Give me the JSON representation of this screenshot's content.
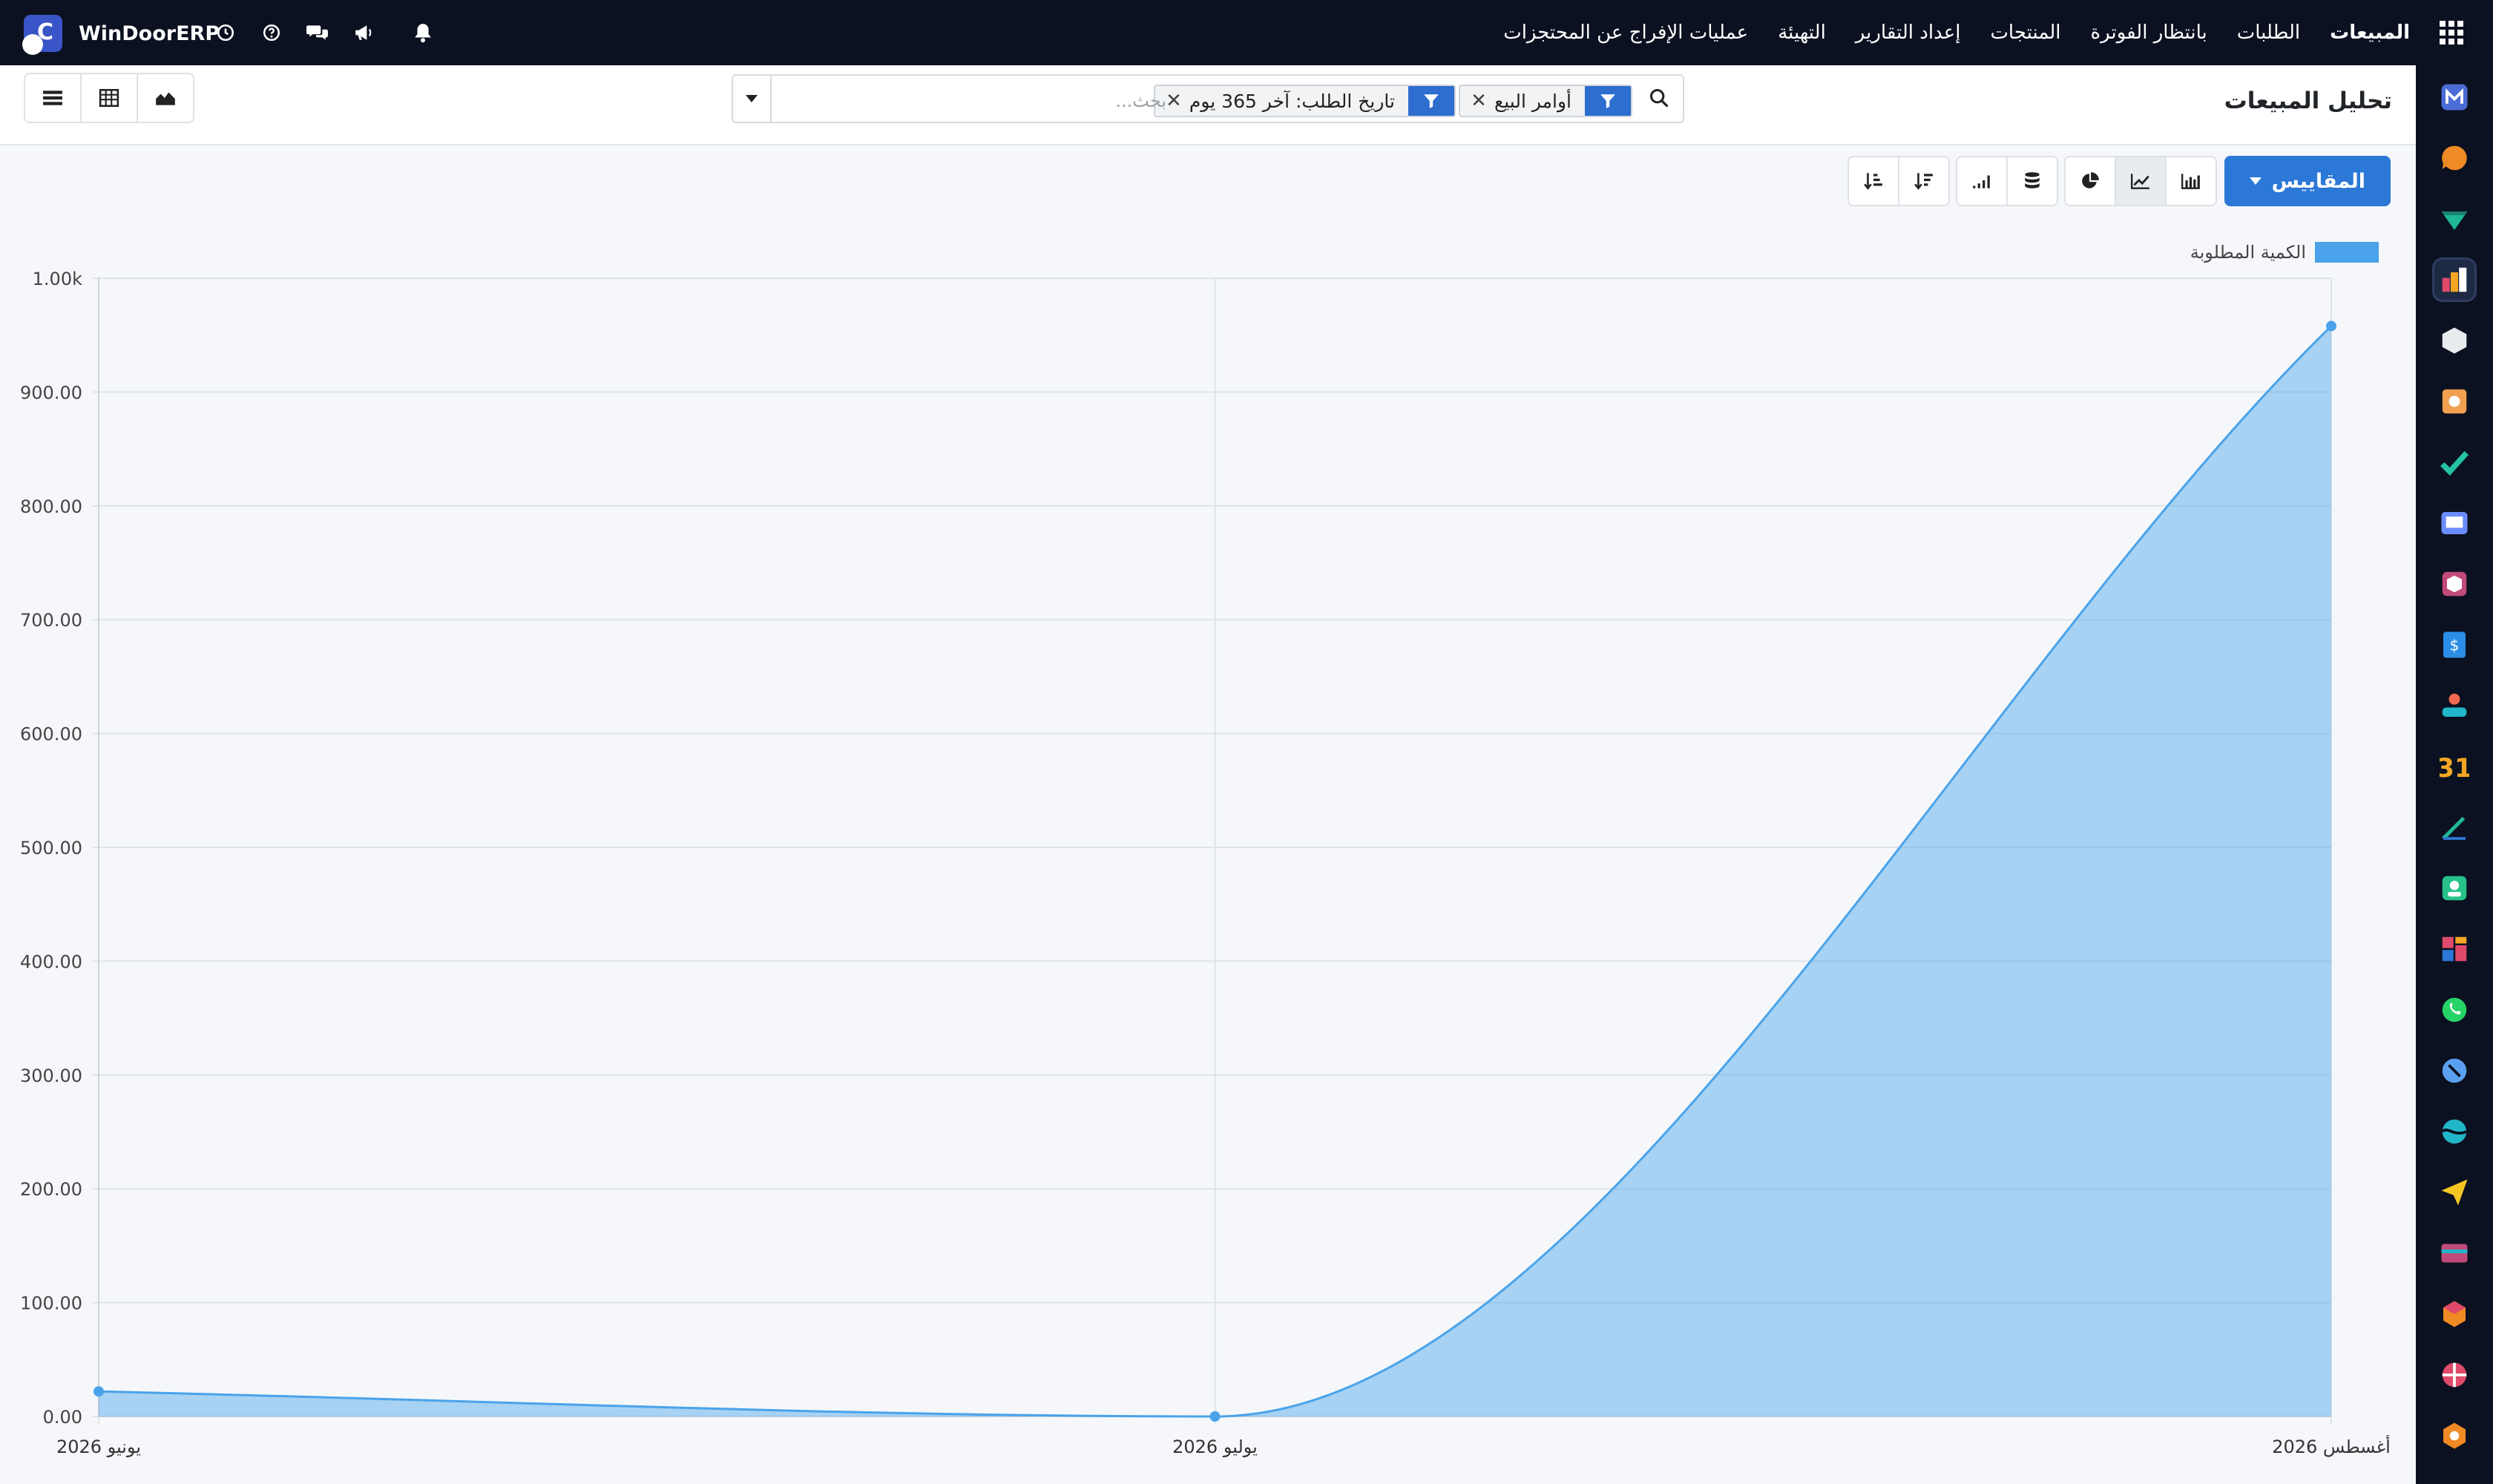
{
  "navbar": {
    "company": "WinDoorERP",
    "logo_letter": "C",
    "menu": [
      "المبيعات",
      "الطلبات",
      "بانتظار الفوترة",
      "المنتجات",
      "إعداد التقارير",
      "التهيئة",
      "عمليات الإفراج عن المحتجزات"
    ]
  },
  "page": {
    "title": "تحليل المبيعات"
  },
  "search": {
    "placeholder": "بحث...",
    "facets": [
      {
        "label": "أوامر البيع"
      },
      {
        "label": "تاريخ الطلب: آخر 365 يوم"
      }
    ]
  },
  "toolbar": {
    "measures_label": "المقاييس"
  },
  "chart_data": {
    "type": "area",
    "x": [
      "يونيو 2026",
      "يوليو 2026",
      "أغسطس 2026"
    ],
    "series": [
      {
        "name": "الكمية المطلوبة",
        "values": [
          22,
          0,
          958
        ],
        "color": "#4aa3ea"
      }
    ],
    "ylim": [
      0,
      1000
    ],
    "yticks": [
      "0.00",
      "100.00",
      "200.00",
      "300.00",
      "400.00",
      "500.00",
      "600.00",
      "700.00",
      "800.00",
      "900.00",
      "1.00k"
    ],
    "grid": true,
    "legend": "top-right"
  },
  "apps": [
    {
      "icon": "m-icon",
      "color": "#4b6cd6"
    },
    {
      "icon": "chat-bubble-icon",
      "color": "#f08a24"
    },
    {
      "icon": "diamond-icon",
      "color": "#21b799"
    },
    {
      "icon": "sales-chart-icon",
      "color": "#f5a623"
    },
    {
      "icon": "box-icon",
      "color": "#e9ecef"
    },
    {
      "icon": "puzzle-icon",
      "color": "#f0a050"
    },
    {
      "icon": "check-icon",
      "color": "#26c2a5"
    },
    {
      "icon": "book-icon",
      "color": "#6b8cff"
    },
    {
      "icon": "cube-icon",
      "color": "#c04a7a"
    },
    {
      "icon": "invoice-icon",
      "color": "#2b8de6"
    },
    {
      "icon": "people-icon",
      "color": "#f06a50"
    },
    {
      "icon": "calendar-icon",
      "color": "#f5a623"
    },
    {
      "icon": "pen-icon",
      "color": "#21b799"
    },
    {
      "icon": "contact-icon",
      "color": "#26c28a"
    },
    {
      "icon": "dashboard-icon",
      "color": "#e04a6a"
    },
    {
      "icon": "whatsapp-icon",
      "color": "#25d366"
    },
    {
      "icon": "compass-icon",
      "color": "#5aa0f0"
    },
    {
      "icon": "wave-icon",
      "color": "#21b7c9"
    },
    {
      "icon": "send-icon",
      "color": "#f5c623"
    },
    {
      "icon": "card-icon",
      "color": "#c04a7a"
    },
    {
      "icon": "hexagon-icon",
      "color": "#f08a24"
    },
    {
      "icon": "pie-icon",
      "color": "#e04a6a"
    },
    {
      "icon": "cog-hex-icon",
      "color": "#f08a24"
    }
  ]
}
